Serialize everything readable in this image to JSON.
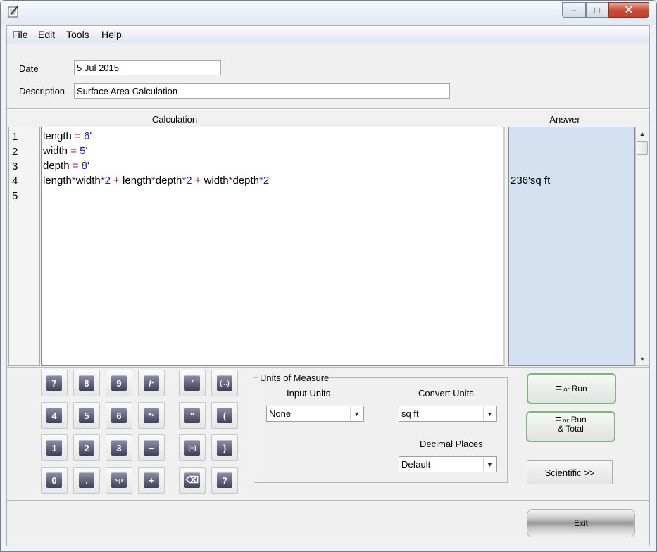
{
  "window": {
    "minimize_glyph": "–",
    "maximize_glyph": "□",
    "close_glyph": "✕"
  },
  "menu": {
    "file": "File",
    "edit": "Edit",
    "tools": "Tools",
    "help": "Help"
  },
  "form": {
    "date_label": "Date",
    "date_value": "5 Jul 2015",
    "description_label": "Description",
    "description_value": "Surface Area Calculation"
  },
  "columns": {
    "calculation": "Calculation",
    "answer": "Answer"
  },
  "line_numbers": [
    "1",
    "2",
    "3",
    "4",
    "5"
  ],
  "code": {
    "line1": {
      "a": "length",
      "op": " = ",
      "v": "6'"
    },
    "line2": {
      "a": "width",
      "op": " = ",
      "v": "5'"
    },
    "line3": {
      "a": "depth",
      "op": " = ",
      "v": "8'"
    },
    "line4": [
      "length",
      "*",
      "width",
      "*",
      "2",
      " + ",
      "length",
      "*",
      "depth",
      "*",
      "2",
      " + ",
      "width",
      "*",
      "depth",
      "*",
      "2"
    ]
  },
  "answers": {
    "line4": "236'sq ft"
  },
  "keypad": {
    "k7": "7",
    "k8": "8",
    "k9": "9",
    "kdiv": "/",
    "kdiv_sub": "÷",
    "kfeet": "′",
    "kparen_group": "(...)",
    "k4": "4",
    "k5": "5",
    "k6": "6",
    "kmul": "*",
    "kmul_sub": "×",
    "kinch": "\"",
    "klparen": "(",
    "k1": "1",
    "k2": "2",
    "k3": "3",
    "kminus": "−",
    "kneg": "(−)",
    "krparen": ")",
    "k0": "0",
    "kdot": ".",
    "ksp": "sp",
    "kplus": "+",
    "kback": "⌫",
    "khelp": "?"
  },
  "units": {
    "group_title": "Units of Measure",
    "input_label": "Input Units",
    "input_value": "None",
    "convert_label": "Convert Units",
    "convert_value": "sq ft",
    "decimal_label": "Decimal Places",
    "decimal_value": "Default"
  },
  "buttons": {
    "run_eq": "=",
    "run_or": "or",
    "run_label": "Run",
    "run_total_label": "Run",
    "run_total_sub": "& Total",
    "scientific": "Scientific >>",
    "exit": "Exit"
  },
  "scrollbar": {
    "up": "▲",
    "down": "▼"
  },
  "dropdown_arrow": "▼",
  "colors": {
    "operator": "#a020a0",
    "number": "#1a1aa8",
    "answer_bg": "#d4e1f1"
  }
}
